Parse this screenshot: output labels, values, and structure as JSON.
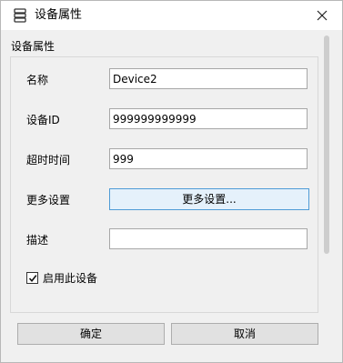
{
  "window": {
    "title": "设备属性",
    "icon": "database-stack-icon",
    "close_icon": "close-icon"
  },
  "group": {
    "label": "设备属性"
  },
  "fields": {
    "name": {
      "label": "名称",
      "value": "Device2"
    },
    "device_id": {
      "label": "设备ID",
      "value": "999999999999"
    },
    "timeout": {
      "label": "超时时间",
      "value": "999"
    },
    "more": {
      "label": "更多设置",
      "button_label": "更多设置..."
    },
    "description": {
      "label": "描述",
      "value": ""
    }
  },
  "enable_checkbox": {
    "label": "启用此设备",
    "checked": true
  },
  "footer": {
    "ok_label": "确定",
    "cancel_label": "取消"
  },
  "colors": {
    "accent_border": "#4e9bd6",
    "accent_fill": "#e5f1fb",
    "dialog_bg": "#f0f0f0"
  }
}
